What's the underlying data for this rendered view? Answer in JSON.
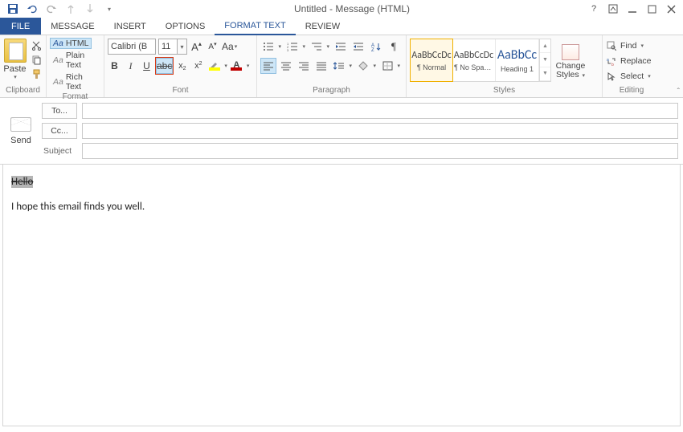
{
  "window": {
    "title": "Untitled - Message (HTML)"
  },
  "tabs": {
    "file": "FILE",
    "items": [
      "MESSAGE",
      "INSERT",
      "OPTIONS",
      "FORMAT TEXT",
      "REVIEW"
    ],
    "active": "FORMAT TEXT"
  },
  "ribbon": {
    "clipboard": {
      "paste": "Paste",
      "label": "Clipboard"
    },
    "format": {
      "html": "HTML",
      "plain": "Plain Text",
      "rich": "Rich Text",
      "label": "Format"
    },
    "font": {
      "name": "Calibri (B",
      "size": "11",
      "label": "Font"
    },
    "paragraph": {
      "label": "Paragraph"
    },
    "styles": {
      "label": "Styles",
      "preview": "AaBbCcDc",
      "preview_h1": "AaBbCc",
      "items": [
        "¶ Normal",
        "¶ No Spac...",
        "Heading 1"
      ],
      "change": "Change Styles"
    },
    "editing": {
      "find": "Find",
      "replace": "Replace",
      "select": "Select",
      "label": "Editing"
    }
  },
  "header": {
    "send": "Send",
    "to": "To...",
    "cc": "Cc...",
    "subject": "Subject"
  },
  "body": {
    "line1": "Hello",
    "line2": "I hope this email finds you well."
  }
}
